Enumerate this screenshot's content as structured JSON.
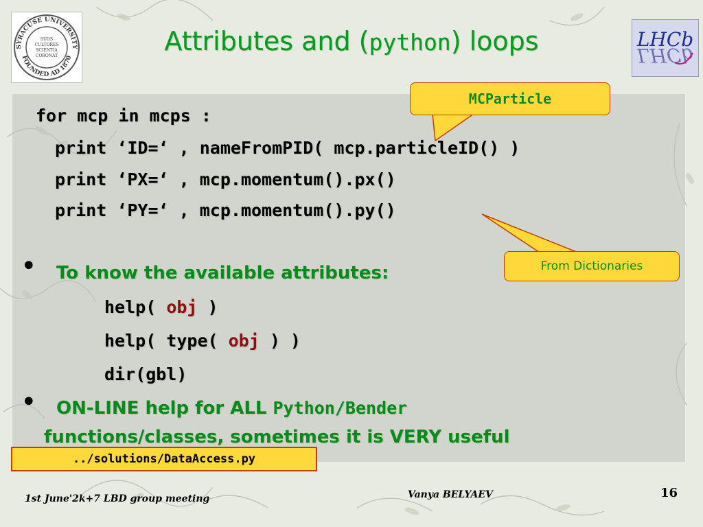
{
  "title": {
    "before": "Attributes and (",
    "mono": "python",
    "after": ") loops"
  },
  "code_lines": [
    "for mcp in mcps :",
    "print ‘ID=‘ , nameFromPID( mcp.particleID() )",
    "print ‘PX=‘ , mcp.momentum().px()",
    "print ‘PY=‘ , mcp.momentum().py()"
  ],
  "callouts": {
    "mcparticle": "MCParticle",
    "dictionaries": "From Dictionaries"
  },
  "bullets": {
    "mark": "•",
    "first": "To know the available attributes:",
    "second_line1_prefix": "ON-LINE help for ALL ",
    "second_line1_mono": "Python/Bender",
    "second_line2": "functions/classes, sometimes it is VERY useful"
  },
  "help_lines": {
    "help1_prefix": "help( ",
    "obj": "obj",
    "help1_suffix": " )",
    "help2_prefix": "help( type( ",
    "help2_suffix": " ) )",
    "dir": "dir(gbl)"
  },
  "solutions_file": "../solutions/DataAccess.py",
  "footer": {
    "left": "1st June'2k+7  LBD group meeting",
    "center": "Vanya  BELYAEV",
    "page": "16"
  },
  "logos": {
    "left_ring_top": "SYRACUSE UNIVERSITY",
    "left_ring_bottom": "FOUNDED AD 1870",
    "left_center_1": "SUOS",
    "left_center_2": "CULTORES",
    "left_center_3": "SCIENTIA",
    "left_center_4": "CORONAT",
    "right_top": "LHCb",
    "right_bottom": "LHCb"
  }
}
